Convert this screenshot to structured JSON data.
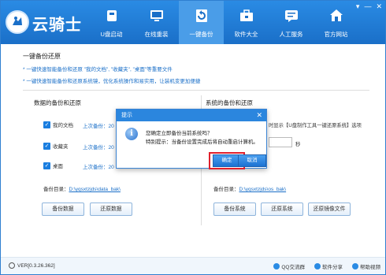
{
  "app": {
    "brand": "云骑士"
  },
  "window_controls": [
    "▾",
    "—",
    "✕"
  ],
  "nav": [
    {
      "label": "U盘启动",
      "icon": "usb-icon"
    },
    {
      "label": "在线重装",
      "icon": "monitor-icon"
    },
    {
      "label": "一键备份",
      "icon": "backup-icon"
    },
    {
      "label": "软件大全",
      "icon": "software-icon"
    },
    {
      "label": "人工服务",
      "icon": "service-icon"
    },
    {
      "label": "官方网站",
      "icon": "home-icon"
    }
  ],
  "active_nav": "一键备份",
  "section_title": "一键备份还原",
  "tips": [
    "* 一键快速智能备份和还原 \"我的文档\", \"收藏夹\", \"桌面\"等重要文件",
    "* 一键快速智能备份和还原系统镜，优化系统操作和易实用，让装机变更加便捷"
  ],
  "data_backup": {
    "title": "数据的备份和还原",
    "items": [
      {
        "label": "我的文档",
        "checked": true,
        "time": "上次备份：20"
      },
      {
        "label": "收藏夹",
        "checked": true,
        "time": "上次备份：20"
      },
      {
        "label": "桌面",
        "checked": true,
        "time": "上次备份：20"
      }
    ],
    "dir_label": "备份目录：",
    "dir_path": "D:\\yqsxtzjds\\data_bak\\",
    "btn_backup": "备份数据",
    "btn_restore": "还原数据"
  },
  "system_backup": {
    "title": "系统的备份和还原",
    "note": "时显示【U盘制作工具一键还原系统】选项",
    "unit": "秒",
    "dir_label": "备份目录：",
    "dir_path": "D:\\yqsxtzjds\\os_bak\\",
    "btn_backup": "备份系统",
    "btn_restore": "还原系统",
    "btn_restore_image": "还原镜像文件"
  },
  "dialog": {
    "title": "提示",
    "message": "您确定立即备份当前系统吗？",
    "note": "特别提示：当备份设置完成后将自动重启计算机。",
    "ok": "确定",
    "cancel": "取消"
  },
  "footer": {
    "version": "VER[0.3.26.362]",
    "links": [
      "QQ交流群",
      "软件分享",
      "帮助视频"
    ]
  },
  "colors": {
    "accent": "#2a8be4",
    "highlight": "#e0202c"
  }
}
